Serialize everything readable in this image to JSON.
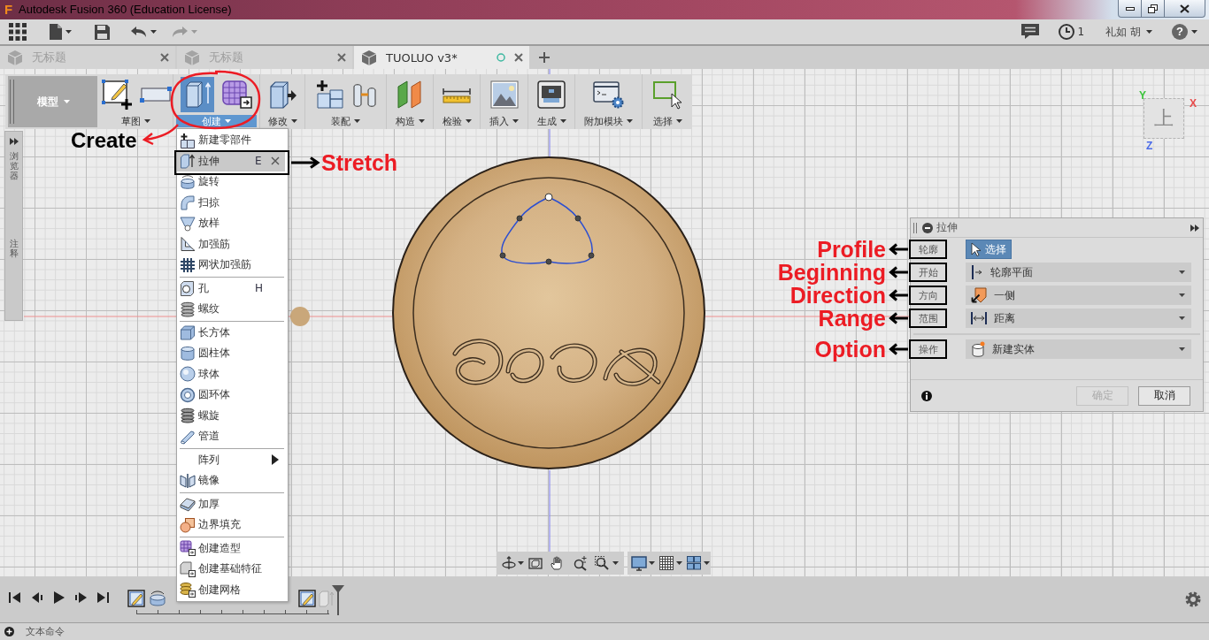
{
  "window": {
    "logo": "F",
    "title": "Autodesk Fusion 360 (Education License)"
  },
  "header": {
    "job_count": "1",
    "user": "礼如 胡",
    "help": "?"
  },
  "document_tabs": [
    {
      "label": "无标题",
      "selected": false
    },
    {
      "label": "无标题",
      "selected": false
    },
    {
      "label": "TUOLUO v3*",
      "selected": true
    }
  ],
  "toolbar": {
    "workspace": "模型",
    "groups": [
      {
        "label": "草图",
        "selected": false
      },
      {
        "label": "创建",
        "selected": true
      },
      {
        "label": "修改",
        "selected": false
      },
      {
        "label": "装配",
        "selected": false
      },
      {
        "label": "构造",
        "selected": false
      },
      {
        "label": "检验",
        "selected": false
      },
      {
        "label": "插入",
        "selected": false
      },
      {
        "label": "生成",
        "selected": false
      },
      {
        "label": "附加模块",
        "selected": false
      },
      {
        "label": "选择",
        "selected": false
      }
    ]
  },
  "side_panel": {
    "tabs": [
      "浏览器",
      "注释"
    ]
  },
  "create_menu": {
    "sections": [
      {
        "items": [
          {
            "kind": "command",
            "label": "新建零部件",
            "selected": false
          },
          {
            "kind": "command",
            "label": "拉伸",
            "shortcut": "E",
            "selected": true
          },
          {
            "kind": "command",
            "label": "旋转",
            "selected": false
          },
          {
            "kind": "command",
            "label": "扫掠",
            "selected": false
          },
          {
            "kind": "command",
            "label": "放样",
            "selected": false
          },
          {
            "kind": "command",
            "label": "加强筋",
            "selected": false
          },
          {
            "kind": "command",
            "label": "网状加强筋",
            "selected": false
          }
        ]
      },
      {
        "items": [
          {
            "kind": "command",
            "label": "孔",
            "shortcut": "H",
            "selected": false
          },
          {
            "kind": "command",
            "label": "螺纹",
            "selected": false
          }
        ]
      },
      {
        "items": [
          {
            "kind": "command",
            "label": "长方体",
            "selected": false
          },
          {
            "kind": "command",
            "label": "圆柱体",
            "selected": false
          },
          {
            "kind": "command",
            "label": "球体",
            "selected": false
          },
          {
            "kind": "command",
            "label": "圆环体",
            "selected": false
          },
          {
            "kind": "command",
            "label": "螺旋",
            "selected": false
          },
          {
            "kind": "command",
            "label": "管道",
            "selected": false
          }
        ]
      },
      {
        "items": [
          {
            "kind": "submenu",
            "label": "阵列",
            "selected": false
          },
          {
            "kind": "command",
            "label": "镜像",
            "selected": false
          }
        ]
      },
      {
        "items": [
          {
            "kind": "command",
            "label": "加厚",
            "selected": false
          },
          {
            "kind": "command",
            "label": "边界填充",
            "selected": false
          }
        ]
      },
      {
        "items": [
          {
            "kind": "command",
            "label": "创建造型",
            "selected": false
          },
          {
            "kind": "command",
            "label": "创建基础特征",
            "selected": false
          },
          {
            "kind": "command",
            "label": "创建网格",
            "selected": false
          }
        ]
      }
    ]
  },
  "view_cube": {
    "face": "上",
    "axes": [
      {
        "label": "Y",
        "color": "#3cc43c"
      },
      {
        "label": "X",
        "color": "#e84a4a"
      },
      {
        "label": "Z",
        "color": "#4a6ae8"
      }
    ]
  },
  "extrude_dialog": {
    "title": "拉伸",
    "inputs": [
      {
        "kind": "select",
        "label": "轮廓",
        "value": "选择",
        "selected": true,
        "annotation": "Profile"
      },
      {
        "kind": "dropdown",
        "label": "开始",
        "value": "轮廓平面",
        "annotation": "Beginning"
      },
      {
        "kind": "dropdown",
        "label": "方向",
        "value": "一侧",
        "annotation": "Direction"
      },
      {
        "kind": "dropdown",
        "label": "范围",
        "value": "距离",
        "annotation": "Range"
      }
    ],
    "operation": {
      "kind": "dropdown",
      "label": "操作",
      "value": "新建实体",
      "annotation": "Option"
    },
    "buttons": [
      {
        "label": "确定",
        "disabled": true
      },
      {
        "label": "取消",
        "disabled": false
      }
    ]
  },
  "annotations": {
    "create": "Create",
    "stretch": "Stretch"
  },
  "status_bar": {
    "command_panel": "文本命令"
  }
}
